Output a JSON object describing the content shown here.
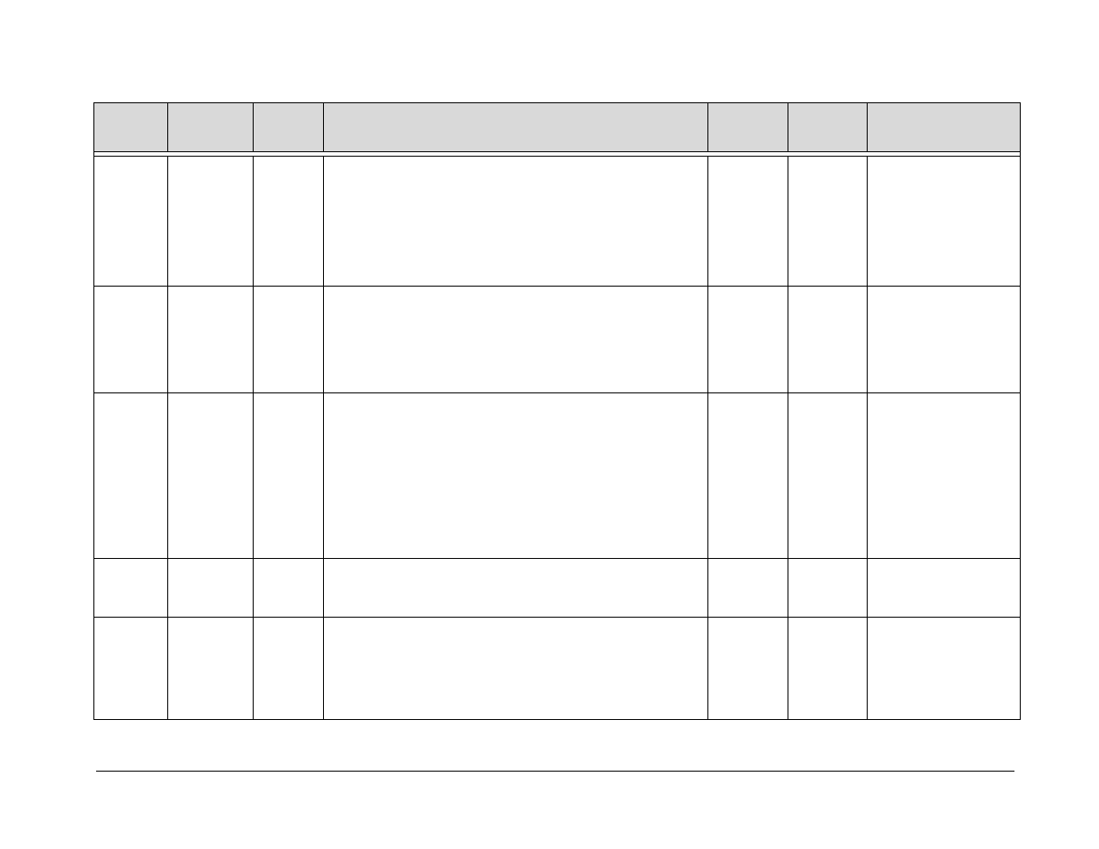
{
  "table": {
    "columns": [
      "",
      "",
      "",
      "",
      "",
      "",
      ""
    ],
    "rows": [
      [
        "",
        "",
        "",
        "",
        "",
        "",
        ""
      ],
      [
        "",
        "",
        "",
        "",
        "",
        "",
        ""
      ],
      [
        "",
        "",
        "",
        "",
        "",
        "",
        ""
      ],
      [
        "",
        "",
        "",
        "",
        "",
        "",
        ""
      ],
      [
        "",
        "",
        "",
        "",
        "",
        "",
        ""
      ]
    ]
  }
}
